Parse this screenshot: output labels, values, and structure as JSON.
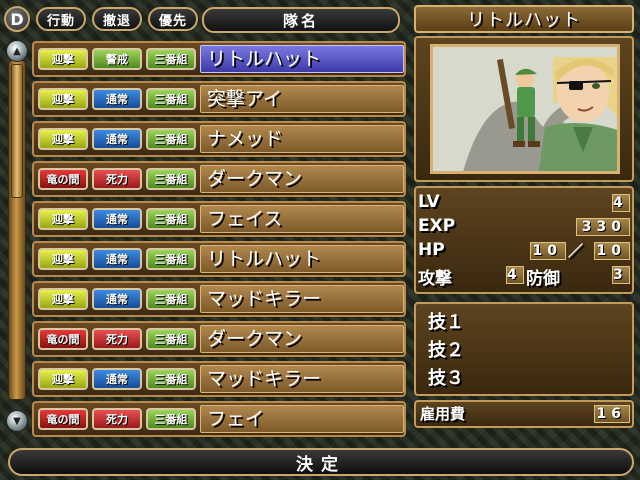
{
  "header": {
    "d_label": "D",
    "action_btn": "行動",
    "retreat_btn": "撤退",
    "priority_btn": "優先",
    "name_col": "隊名"
  },
  "roster": [
    {
      "t1": "迎撃",
      "t2": "警戒",
      "t3": "三番組",
      "name": "リトルハット",
      "c2": "green",
      "c1": "yellow",
      "selected": true
    },
    {
      "t1": "迎撃",
      "t2": "通常",
      "t3": "三番組",
      "name": "突撃アイ",
      "c1": "yellow",
      "c2": "blue"
    },
    {
      "t1": "迎撃",
      "t2": "通常",
      "t3": "三番組",
      "name": "ナメッド",
      "c1": "yellow",
      "c2": "blue"
    },
    {
      "t1": "竜の間",
      "t2": "死力",
      "t3": "三番組",
      "name": "ダークマン",
      "c1": "red",
      "c2": "pink"
    },
    {
      "t1": "迎撃",
      "t2": "通常",
      "t3": "三番組",
      "name": "フェイス",
      "c1": "yellow",
      "c2": "blue"
    },
    {
      "t1": "迎撃",
      "t2": "通常",
      "t3": "三番組",
      "name": "リトルハット",
      "c1": "yellow",
      "c2": "blue"
    },
    {
      "t1": "迎撃",
      "t2": "通常",
      "t3": "三番組",
      "name": "マッドキラー",
      "c1": "yellow",
      "c2": "blue"
    },
    {
      "t1": "竜の間",
      "t2": "死力",
      "t3": "三番組",
      "name": "ダークマン",
      "c1": "red",
      "c2": "pink"
    },
    {
      "t1": "迎撃",
      "t2": "通常",
      "t3": "三番組",
      "name": "マッドキラー",
      "c1": "yellow",
      "c2": "blue"
    },
    {
      "t1": "竜の間",
      "t2": "死力",
      "t3": "三番組",
      "name": "フェイ",
      "c1": "red",
      "c2": "pink"
    }
  ],
  "unit": {
    "name": "リトルハット",
    "lv_label": "LV",
    "lv": "4",
    "exp_label": "EXP",
    "exp": "330",
    "hp_label": "HP",
    "hp_cur": "10",
    "hp_sep": "／",
    "hp_max": "10",
    "atk_label": "攻撃",
    "atk": "4",
    "def_label": "防御",
    "def": "3",
    "skills": [
      "技１",
      "技２",
      "技３"
    ],
    "cost_label": "雇用費",
    "cost": "16"
  },
  "footer": {
    "confirm": "決定"
  }
}
